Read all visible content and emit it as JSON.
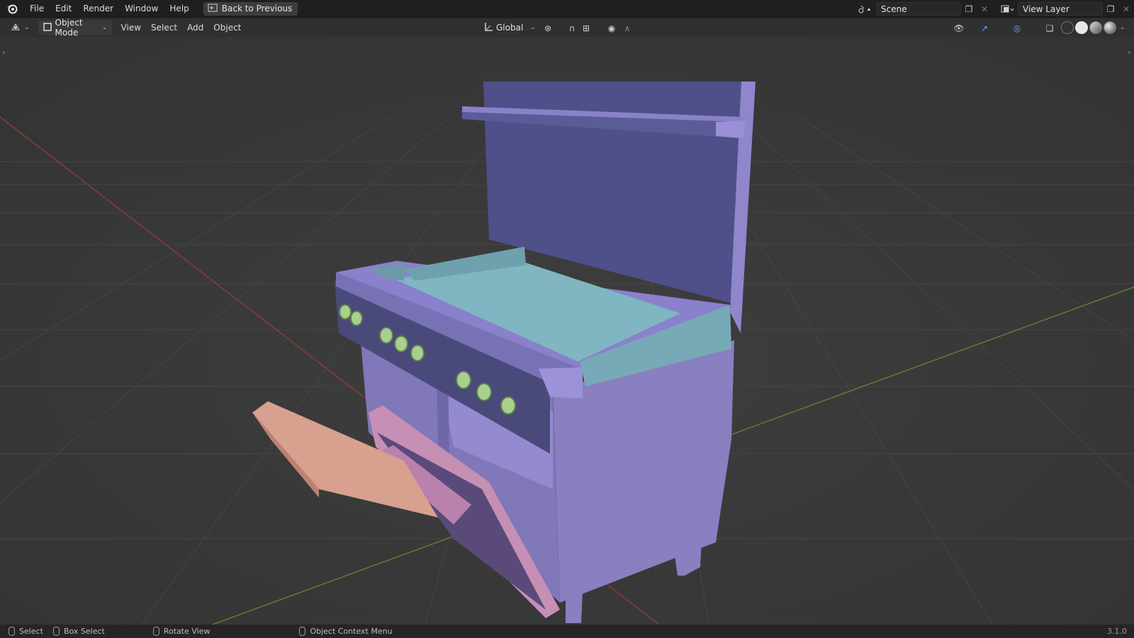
{
  "topbar": {
    "menus": [
      "File",
      "Edit",
      "Render",
      "Window",
      "Help"
    ],
    "back_label": "Back to Previous",
    "scene": "Scene",
    "view_layer": "View Layer"
  },
  "header": {
    "mode": "Object Mode",
    "menus": [
      "View",
      "Select",
      "Add",
      "Object"
    ],
    "transform_orientation": "Global"
  },
  "statusbar": {
    "select": "Select",
    "box_select": "Box Select",
    "rotate_view": "Rotate View",
    "context_menu": "Object Context Menu",
    "version": "3.1.0"
  },
  "colors": {
    "stove_body": "#8a7fc0",
    "griddle": "#7fb6c2",
    "door": "#c68fb4",
    "tray": "#d7a08f",
    "knobs": "#a8d08c",
    "x_axis": "#8e3a3a",
    "y_axis": "#5f7d2f"
  },
  "icons": {
    "app": "blender-logo-icon",
    "scene": "scene-icon",
    "view_layer": "view-layer-icon"
  }
}
